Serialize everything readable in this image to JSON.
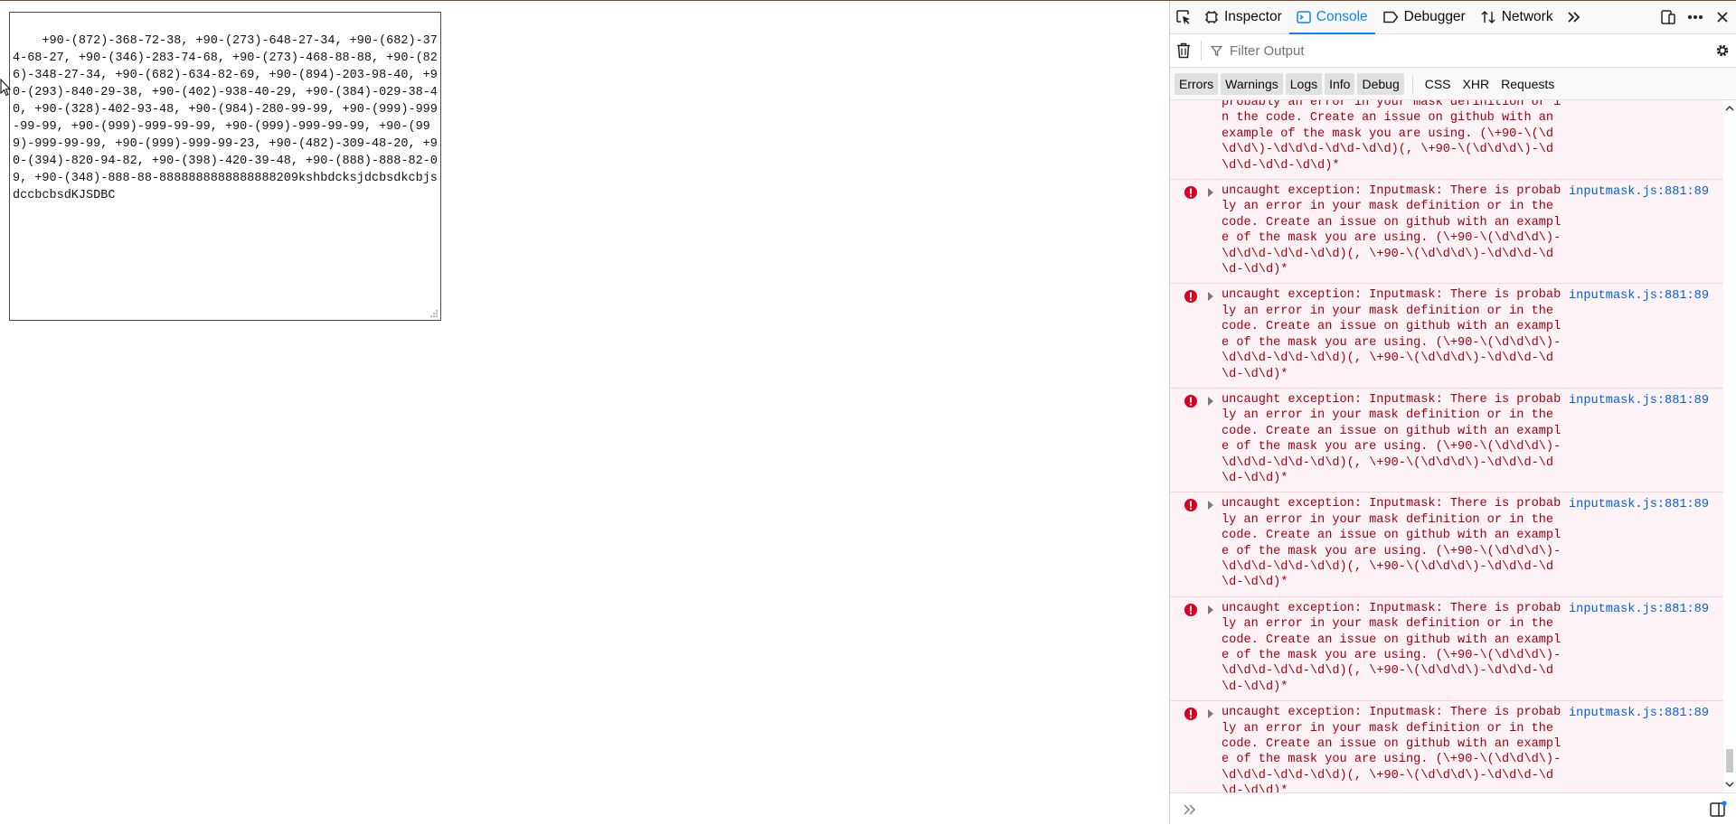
{
  "page": {
    "textarea_value": "+90-(872)-368-72-38, +90-(273)-648-27-34, +90-(682)-374-68-27, +90-(346)-283-74-68, +90-(273)-468-88-88, +90-(826)-348-27-34, +90-(682)-634-82-69, +90-(894)-203-98-40, +90-(293)-840-29-38, +90-(402)-938-40-29, +90-(384)-029-38-40, +90-(328)-402-93-48, +90-(984)-280-99-99, +90-(999)-999-99-99, +90-(999)-999-99-99, +90-(999)-999-99-99, +90-(999)-999-99-99, +90-(999)-999-99-23, +90-(482)-309-48-20, +90-(394)-820-94-82, +90-(398)-420-39-48, +90-(888)-888-82-09, +90-(348)-888-88-8888888888888888209kshbdcksjdcbsdkcbjsdccbcbsdKJSDBC"
  },
  "devtools": {
    "tabs": [
      {
        "label": "Inspector",
        "icon": "inspector-icon"
      },
      {
        "label": "Console",
        "icon": "console-icon",
        "active": true
      },
      {
        "label": "Debugger",
        "icon": "debugger-icon"
      },
      {
        "label": "Network",
        "icon": "network-icon"
      }
    ],
    "filter_placeholder": "Filter Output",
    "categories": [
      "Errors",
      "Warnings",
      "Logs",
      "Info",
      "Debug"
    ],
    "request_categories": [
      "CSS",
      "XHR",
      "Requests"
    ],
    "partial_message_text": "probably an error in your mask definition or in the code. Create an issue on github with an example of the mask you are using. (\\+90-\\(\\d\\d\\d\\)-\\d\\d\\d-\\d\\d-\\d\\d)(, \\+90-\\(\\d\\d\\d\\)-\\d\\d\\d-\\d\\d-\\d\\d)*",
    "messages": [
      {
        "text": "uncaught exception: Inputmask: There is probably an error in your mask definition or in the code. Create an issue on github with an example of the mask you are using. (\\+90-\\(\\d\\d\\d\\)-\\d\\d\\d-\\d\\d-\\d\\d)(, \\+90-\\(\\d\\d\\d\\)-\\d\\d\\d-\\d\\d-\\d\\d)*",
        "source": "inputmask.js:881:89"
      },
      {
        "text": "uncaught exception: Inputmask: There is probably an error in your mask definition or in the code. Create an issue on github with an example of the mask you are using. (\\+90-\\(\\d\\d\\d\\)-\\d\\d\\d-\\d\\d-\\d\\d)(, \\+90-\\(\\d\\d\\d\\)-\\d\\d\\d-\\d\\d-\\d\\d)*",
        "source": "inputmask.js:881:89"
      },
      {
        "text": "uncaught exception: Inputmask: There is probably an error in your mask definition or in the code. Create an issue on github with an example of the mask you are using. (\\+90-\\(\\d\\d\\d\\)-\\d\\d\\d-\\d\\d-\\d\\d)(, \\+90-\\(\\d\\d\\d\\)-\\d\\d\\d-\\d\\d-\\d\\d)*",
        "source": "inputmask.js:881:89"
      },
      {
        "text": "uncaught exception: Inputmask: There is probably an error in your mask definition or in the code. Create an issue on github with an example of the mask you are using. (\\+90-\\(\\d\\d\\d\\)-\\d\\d\\d-\\d\\d-\\d\\d)(, \\+90-\\(\\d\\d\\d\\)-\\d\\d\\d-\\d\\d-\\d\\d)*",
        "source": "inputmask.js:881:89"
      },
      {
        "text": "uncaught exception: Inputmask: There is probably an error in your mask definition or in the code. Create an issue on github with an example of the mask you are using. (\\+90-\\(\\d\\d\\d\\)-\\d\\d\\d-\\d\\d-\\d\\d)(, \\+90-\\(\\d\\d\\d\\)-\\d\\d\\d-\\d\\d-\\d\\d)*",
        "source": "inputmask.js:881:89"
      },
      {
        "text": "uncaught exception: Inputmask: There is probably an error in your mask definition or in the code. Create an issue on github with an example of the mask you are using. (\\+90-\\(\\d\\d\\d\\)-\\d\\d\\d-\\d\\d-\\d\\d)(, \\+90-\\(\\d\\d\\d\\)-\\d\\d\\d-\\d\\d-\\d\\d)*",
        "source": "inputmask.js:881:89"
      }
    ]
  },
  "colors": {
    "error_text": "#a4000f",
    "error_bg": "#fdf2f5",
    "active_tab": "#0a84ff",
    "link": "#0060df"
  }
}
